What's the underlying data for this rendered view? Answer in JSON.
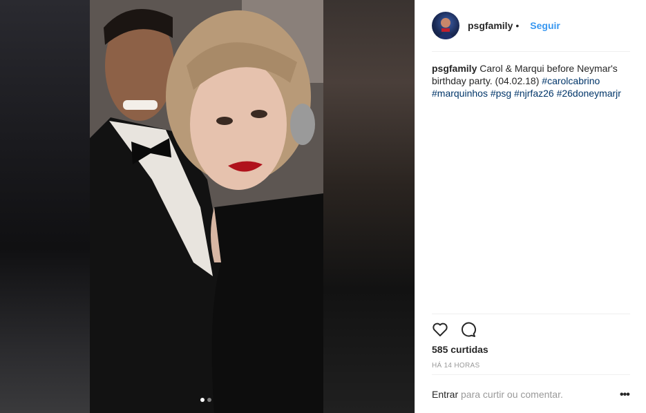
{
  "post": {
    "username": "psgfamily",
    "separator": "•",
    "follow_label": "Seguir",
    "caption_user": "psgfamily",
    "caption_text": "Carol & Marqui before Neymar's birthday party. (04.02.18)",
    "hashtags": [
      "#carolcabrino",
      "#marquinhos",
      "#psg",
      "#njrfaz26",
      "#26doneymarjr"
    ],
    "likes": "585 curtidas",
    "timestamp": "HÁ 14 HORAS",
    "comment_login": "Entrar",
    "comment_rest": "para curtir ou comentar.",
    "more_label": "•••"
  },
  "carousel": {
    "total": 2,
    "active_index": 0
  },
  "colors": {
    "link": "#3897f0",
    "hashtag": "#003569",
    "muted": "#999999",
    "divider": "#efefef"
  },
  "icons": {
    "like": "heart-outline-icon",
    "comment": "comment-bubble-icon",
    "more": "ellipsis-icon"
  }
}
